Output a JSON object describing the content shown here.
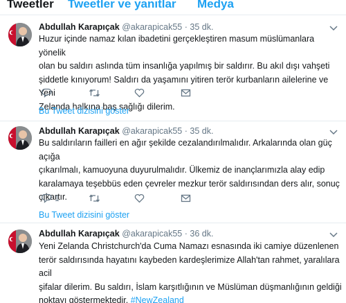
{
  "tabs": [
    {
      "label": "Tweetler"
    },
    {
      "label": "Tweetler ve yanıtlar"
    },
    {
      "label": "Medya"
    }
  ],
  "tweets": [
    {
      "name": "Abdullah Karapıçak",
      "handle": "@akarapicak55",
      "separator": "·",
      "time": "35 dk.",
      "lines": [
        "Huzur içinde namaz kılan ibadetini gerçekleştiren masum müslümanlara yönelik",
        "olan bu saldırı aslında tüm insanlığa yapılmış bir saldırır. Bu akıl dışı vahşeti",
        "şiddetle kınıyorum! Saldırı da yaşamını yitiren terör kurbanların ailelerine ve Yeni",
        "Zelanda halkına baş sağlığı dilerim."
      ],
      "reply_count": "",
      "thread_link": "Bu Tweet dizisini göster"
    },
    {
      "name": "Abdullah Karapıçak",
      "handle": "@akarapicak55",
      "separator": "·",
      "time": "35 dk.",
      "lines": [
        "Bu saldırıların failleri en ağır şekilde cezalandırılmalıdır. Arkalarında olan güç açığa",
        "çıkarılmalı, kamuoyuna duyurulmalıdır. Ülkemiz de inançlarımızla alay edip",
        "karalamaya teşebbüs eden çevreler mezkur terör saldırısından ders alır, sonuç",
        "çıkartır."
      ],
      "reply_count": "1",
      "thread_link": "Bu Tweet dizisini göster"
    },
    {
      "name": "Abdullah Karapıçak",
      "handle": "@akarapicak55",
      "separator": "·",
      "time": "36 dk.",
      "lines": [
        "Yeni Zelanda Christchurch'da Cuma Namazı esnasında iki camiye düzenlenen",
        "terör saldırısında hayatını kaybeden kardeşlerimize Allah'tan rahmet, yaralılara acil",
        "şifalar dilerim. Bu saldırı, İslam karşıtlığının ve Müslüman düşmanlığının geldiği"
      ],
      "last_line_text": "noktayı göstermektedir. ",
      "hashtag": "#NewZealand"
    }
  ]
}
